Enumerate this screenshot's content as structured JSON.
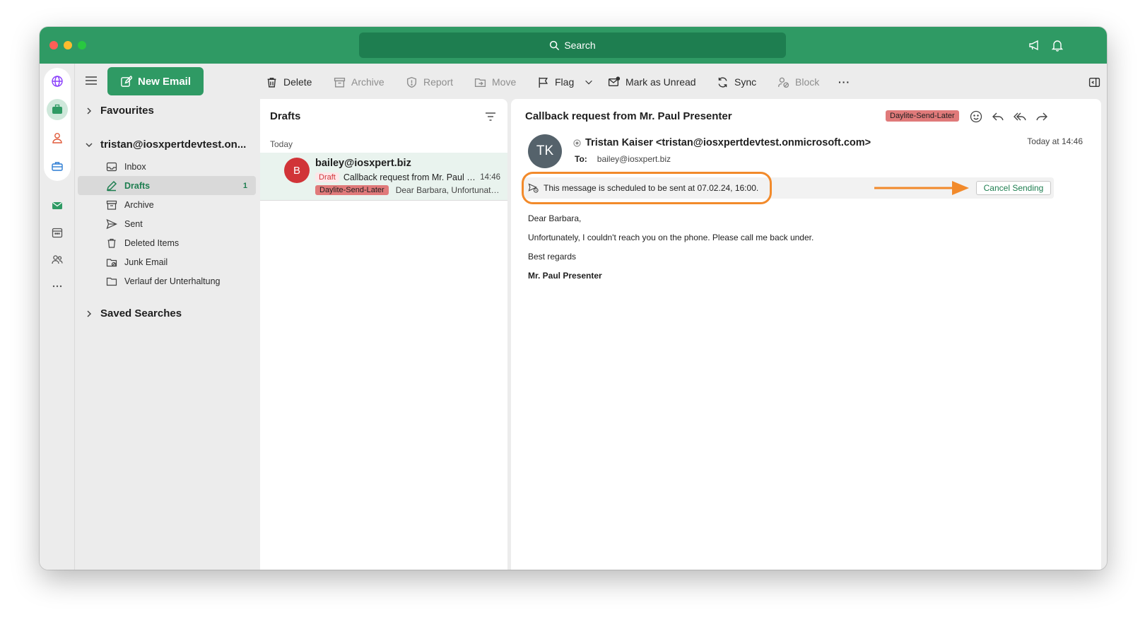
{
  "titlebar": {
    "search_placeholder": "Search"
  },
  "colors": {
    "accent": "#2f9a64",
    "accent_dark": "#1e7e50",
    "highlight": "#f28a2b",
    "category_pill": "#e07a7a"
  },
  "rail": {
    "icons": [
      "globe-icon",
      "briefcase-icon",
      "person-icon",
      "toolbox-icon",
      "mail-icon",
      "calendar-icon",
      "people-icon",
      "more-icon"
    ]
  },
  "sidebar": {
    "new_email_label": "New Email",
    "favourites_label": "Favourites",
    "account_label": "tristan@iosxpertdevtest.on...",
    "folders": [
      {
        "label": "Inbox",
        "icon": "inbox-icon",
        "count": ""
      },
      {
        "label": "Drafts",
        "icon": "pencil-icon",
        "count": "1"
      },
      {
        "label": "Archive",
        "icon": "archive-icon",
        "count": ""
      },
      {
        "label": "Sent",
        "icon": "send-icon",
        "count": ""
      },
      {
        "label": "Deleted Items",
        "icon": "trash-icon",
        "count": ""
      },
      {
        "label": "Junk Email",
        "icon": "junk-icon",
        "count": ""
      },
      {
        "label": "Verlauf der Unterhaltung",
        "icon": "folder-icon",
        "count": ""
      }
    ],
    "saved_searches_label": "Saved Searches"
  },
  "toolbar": {
    "delete": "Delete",
    "archive": "Archive",
    "report": "Report",
    "move": "Move",
    "flag": "Flag",
    "mark_unread": "Mark as Unread",
    "sync": "Sync",
    "block": "Block",
    "more": "···"
  },
  "message_list": {
    "title": "Drafts",
    "group": "Today",
    "items": [
      {
        "avatar_letter": "B",
        "from": "bailey@iosxpert.biz",
        "draft_tag": "Draft",
        "subject": "Callback request from Mr. Paul Presenter",
        "time": "14:46",
        "category": "Daylite-Send-Later",
        "preview": "Dear Barbara, Unfortunately, I couldn't reach you on the phone."
      }
    ]
  },
  "reading": {
    "subject": "Callback request from Mr. Paul Presenter",
    "category": "Daylite-Send-Later",
    "avatar_initials": "TK",
    "sender": "Tristan Kaiser <tristan@iosxpertdevtest.onmicrosoft.com>",
    "to_label": "To:",
    "to_value": "bailey@iosxpert.biz",
    "time": "Today at 14:46",
    "schedule_notice": "This message is scheduled to be sent at 07.02.24, 16:00.",
    "cancel_label": "Cancel Sending",
    "body": [
      "Dear  Barbara,",
      "Unfortunately, I couldn't reach you on the phone. Please call me back under.",
      "Best regards",
      "Mr. Paul Presenter"
    ]
  }
}
